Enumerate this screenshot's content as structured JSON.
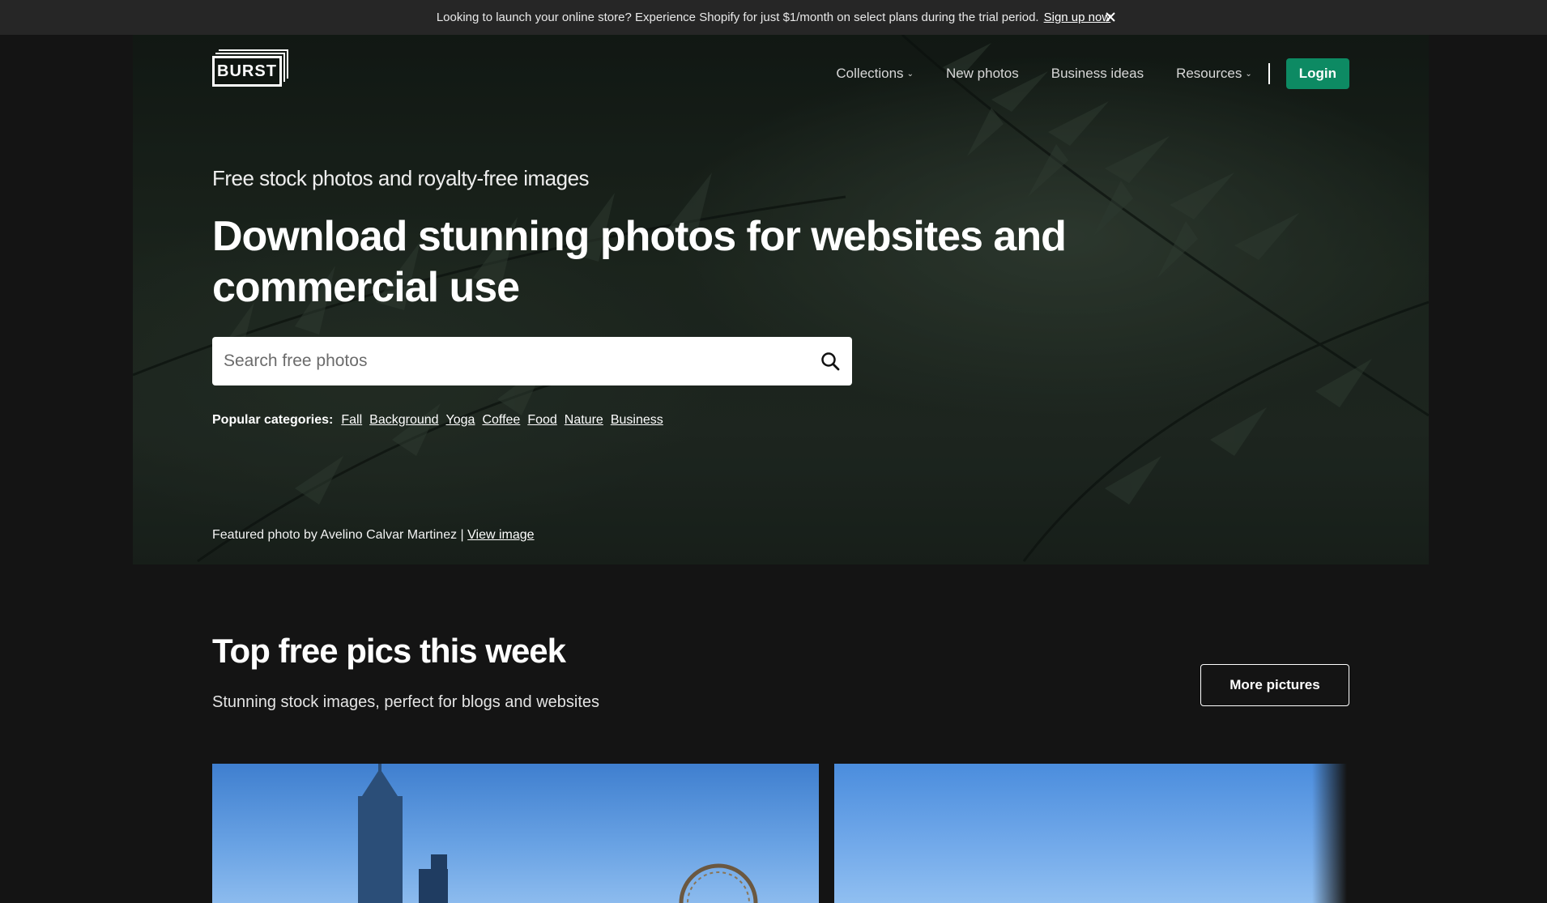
{
  "announcement": {
    "message": "Looking to launch your online store? Experience Shopify for just $1/month on select plans during the trial period.",
    "link": "Sign up now",
    "close_icon": "close-icon"
  },
  "header": {
    "logo_text": "BURST",
    "nav": {
      "collections": "Collections",
      "new_photos": "New photos",
      "business_ideas": "Business ideas",
      "resources": "Resources",
      "login": "Login"
    }
  },
  "hero": {
    "tagline": "Free stock photos and royalty-free images",
    "headline": "Download stunning photos for websites and commercial use",
    "search": {
      "placeholder": "Search free photos",
      "icon": "search-icon"
    },
    "popular_label": "Popular categories:",
    "categories": [
      "Fall",
      "Background",
      "Yoga",
      "Coffee",
      "Food",
      "Nature",
      "Business"
    ],
    "credit_prefix": "Featured photo by Avelino Calvar Martinez |",
    "credit_link": "View image"
  },
  "top_pics": {
    "title": "Top free pics this week",
    "subtitle": "Stunning stock images, perfect for blogs and websites",
    "more_button": "More pictures"
  },
  "colors": {
    "page_bg": "#141414",
    "banner_bg": "#262626",
    "login_green": "#0d8a63"
  }
}
